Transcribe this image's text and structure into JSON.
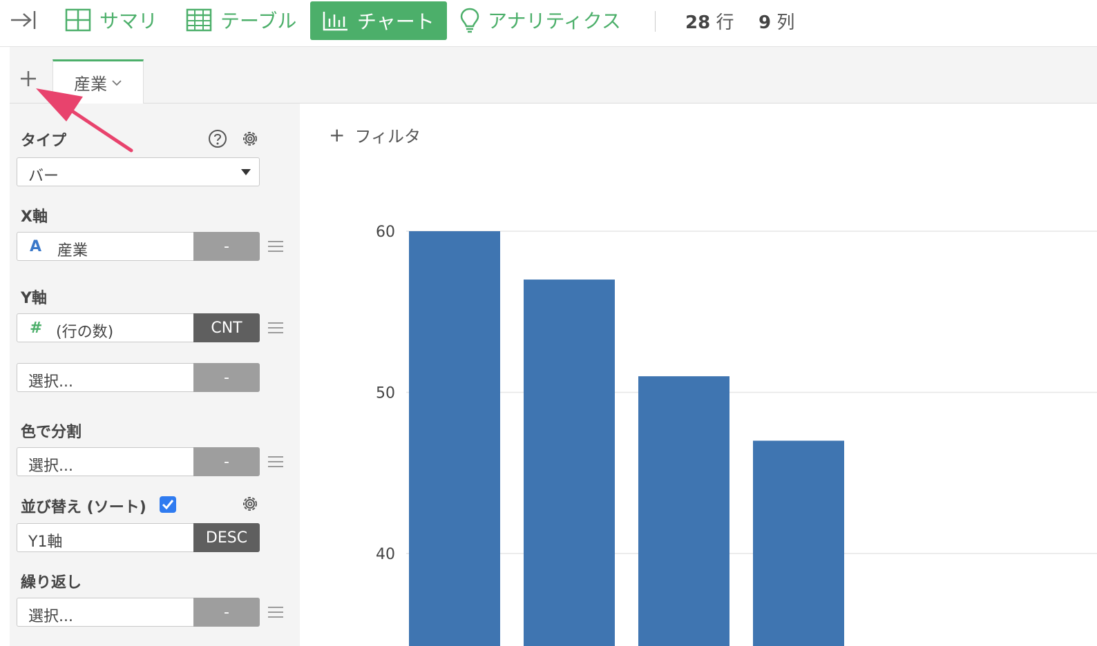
{
  "topbar": {
    "summary_label": "サマリ",
    "table_label": "テーブル",
    "chart_label": "チャート",
    "analytics_label": "アナリティクス",
    "rows_value": "28",
    "rows_unit": "行",
    "cols_value": "9",
    "cols_unit": "列",
    "accent_color": "#4caf6a"
  },
  "tabs": [
    {
      "label": "産業",
      "active": true
    }
  ],
  "panel": {
    "type_label": "タイプ",
    "type_value": "バー",
    "x_axis_label": "X軸",
    "x_axis_field": "産業",
    "x_axis_field_type_icon": "A",
    "x_axis_agg": "-",
    "y_axis_label": "Y軸",
    "y_axis_field": "(行の数)",
    "y_axis_field_type_icon": "#",
    "y_axis_agg": "CNT",
    "y_axis_extra_placeholder": "選択...",
    "y_axis_extra_agg": "-",
    "color_label": "色で分割",
    "color_placeholder": "選択...",
    "color_agg": "-",
    "sort_label": "並び替え (ソート)",
    "sort_checked": true,
    "sort_field": "Y1軸",
    "sort_order": "DESC",
    "repeat_label": "繰り返し",
    "repeat_placeholder": "選択...",
    "repeat_agg": "-"
  },
  "filter": {
    "label": "フィルタ"
  },
  "chart_data": {
    "type": "bar",
    "values": [
      60,
      57,
      51,
      47
    ],
    "y_ticks": [
      40,
      50,
      60
    ],
    "ylim": [
      35,
      63
    ],
    "grid": true,
    "bar_color": "#3f75b1"
  }
}
